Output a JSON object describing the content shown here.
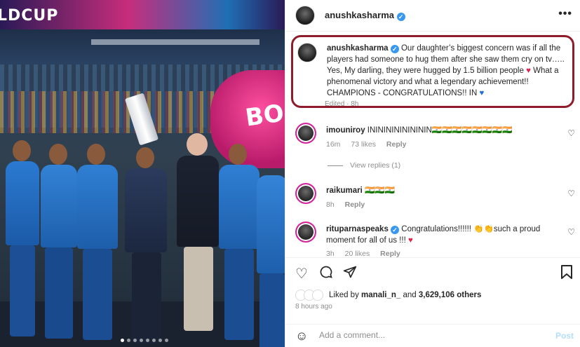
{
  "photo": {
    "banner_text": "LDCUP",
    "sign_text": "BO"
  },
  "header": {
    "username": "anushkasharma",
    "more_icon": "more-horizontal-icon"
  },
  "caption": {
    "username": "anushkasharma",
    "text": "Our daughter’s biggest concern was if all the players had someone to hug them after she saw them cry on tv….. Yes, My darling, they were hugged by 1.5 billion people",
    "text2": "What a phenomenal victory and what a legendary achievement!! CHAMPIONS - CONGRATULATIONS!! IN",
    "edited": "Edited · 8h"
  },
  "comments": [
    {
      "username": "imouniroy",
      "text": "ININININININININ🇮🇳🇮🇳🇮🇳🇮🇳🇮🇳🇮🇳🇮🇳🇮🇳",
      "time": "16m",
      "likes": "73 likes",
      "reply": "Reply"
    },
    {
      "username": "raikumari",
      "text": "🇮🇳🇮🇳🇮🇳",
      "time": "8h",
      "reply": "Reply"
    },
    {
      "username": "rituparnaspeaks",
      "text": "Congratulations!!!!!! 👏👏such a proud moment for all of us !!!",
      "time": "3h",
      "likes": "20 likes",
      "reply": "Reply"
    }
  ],
  "view_replies": "View replies (1)",
  "likes": {
    "prefix": "Liked by",
    "user": "manali_n_",
    "middle": "and",
    "count": "3,629,106 others"
  },
  "post_time": "8 hours ago",
  "add_comment": {
    "placeholder": "Add a comment...",
    "post_label": "Post"
  },
  "colors": {
    "accent": "#3897f0",
    "highlight_border": "#8f1c2a",
    "heart_red": "#e0244c",
    "heart_blue": "#1e6fd9"
  }
}
